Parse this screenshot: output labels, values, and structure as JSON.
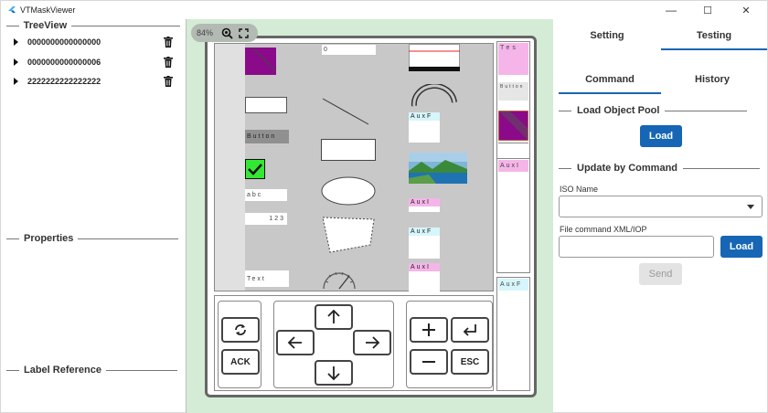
{
  "window": {
    "title": "VTMaskViewer",
    "controls": {
      "minimize": "—",
      "maximize": "☐",
      "close": "✕"
    }
  },
  "left": {
    "treeview_title": "TreeView",
    "items": [
      {
        "label": "0000000000000000"
      },
      {
        "label": "0000000000000006"
      },
      {
        "label": "2222222222222222"
      }
    ],
    "properties_title": "Properties",
    "label_reference_title": "Label Reference"
  },
  "viewer": {
    "zoom": "84%",
    "mask_texts": {
      "number_field": "0",
      "button": "Button",
      "abc": "abc",
      "num123": "123",
      "text": "Text",
      "auxf1": "AuxF",
      "auxi1": "AuxI",
      "auxf2": "AuxF",
      "auxi2": "AuxI"
    },
    "side": {
      "tes": "Tes",
      "button": "Button",
      "auxi": "AuxI",
      "auxf": "AuxF"
    },
    "softkeys": {
      "ack": "ACK",
      "esc": "ESC"
    }
  },
  "right": {
    "tabs": [
      "Setting",
      "Testing"
    ],
    "active_tab": "Testing",
    "subtabs": [
      "Command",
      "History"
    ],
    "active_subtab": "Command",
    "load_object_pool": {
      "title": "Load Object Pool",
      "button": "Load"
    },
    "update_by_command": {
      "title": "Update by Command",
      "iso_name_label": "ISO Name",
      "iso_name_value": "",
      "file_label": "File command XML/IOP",
      "file_value": "",
      "load_button": "Load",
      "send_button": "Send"
    }
  },
  "colors": {
    "accent": "#1666b5",
    "viewer_bg": "#d4ecd5",
    "mask_bg": "#c8c8c8",
    "purple": "#8a0a8a",
    "cyan": "#d6f6fb",
    "pink": "#f5b5e8"
  }
}
